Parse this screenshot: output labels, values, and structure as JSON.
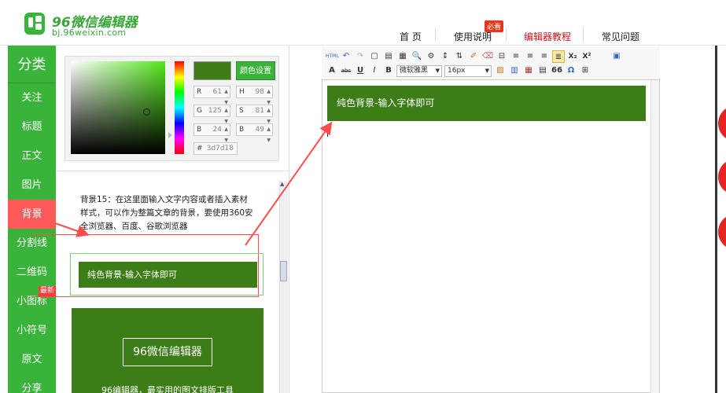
{
  "header": {
    "logo_title": "96微信编辑器",
    "logo_url": "bj.96weixin.com",
    "nav": [
      "首 页",
      "使用说明",
      "编辑器教程",
      "常见问题"
    ],
    "nav_badge": "必看"
  },
  "sidebar": {
    "title": "分类",
    "items": [
      "关注",
      "标题",
      "正文",
      "图片",
      "背景",
      "分割线",
      "二维码",
      "小图标",
      "小符号",
      "原文",
      "分享"
    ],
    "active": "背景",
    "new_badge": "最新"
  },
  "color_picker": {
    "button": "颜色设置",
    "swatch_color": "#3d7d18",
    "fields": [
      {
        "label": "R",
        "value": "61"
      },
      {
        "label": "H",
        "value": "98"
      },
      {
        "label": "G",
        "value": "125"
      },
      {
        "label": "S",
        "value": "81"
      },
      {
        "label": "B",
        "value": "24"
      },
      {
        "label": "B",
        "value": "49"
      }
    ],
    "hex_label": "#",
    "hex_value": "3d7d18"
  },
  "template": {
    "description": "背景15：在这里面输入文字内容或者插入素材样式，可以作为整篇文章的背景，要使用360安全浏览器、百度、谷歌浏览器",
    "bar_text": "纯色背景-输入字体即可",
    "card_title": "96微信编辑器",
    "card_subtitle": "96编辑器，最实用的图文排版工具"
  },
  "editor": {
    "font_family": "微软雅黑",
    "font_size": "16px",
    "content_text": "纯色背景-输入字体即可",
    "toolbar_row1": [
      "HTML",
      "↶",
      "↷",
      "▢",
      "▤",
      "▦",
      "🔍",
      "⚙",
      "↕",
      "⇅",
      "✐",
      "⌫",
      "⊟",
      "≡",
      "≡",
      "≡",
      "≣",
      "X₂",
      "X²",
      "▣"
    ],
    "toolbar_row2": [
      "A",
      "abc",
      "U",
      "I",
      "B"
    ],
    "toolbar_row2_tail": [
      "▨",
      "▥",
      "▦",
      "▤",
      "66",
      "Ω",
      "⊞"
    ]
  },
  "colors": {
    "brand_green": "#3ab33a",
    "template_green": "#3d7d18",
    "accent_red": "#ff4d4d"
  }
}
